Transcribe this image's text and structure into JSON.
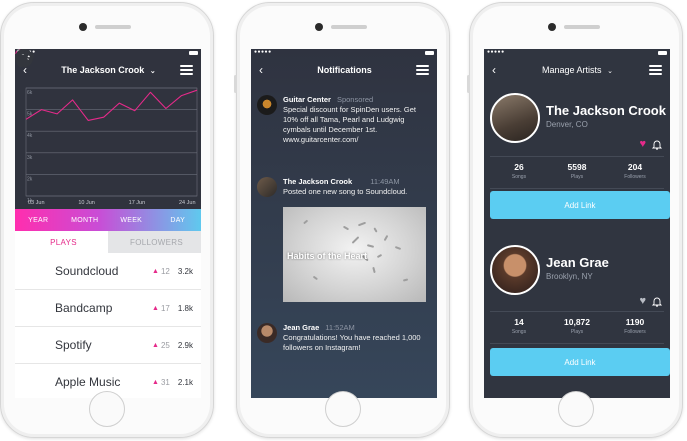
{
  "phones": {
    "analytics": {
      "header": {
        "title": "The Jackson Crook",
        "dropdown_icon": "chevron-down-icon"
      },
      "chart_data": {
        "type": "line",
        "x_ticks": [
          "03 Jun",
          "10 Jun",
          "17 Jun",
          "24 Jun"
        ],
        "y_ticks": [
          "6k",
          "5k",
          "4k",
          "3k",
          "2k",
          "1k"
        ],
        "ylim": [
          1000,
          6000
        ],
        "series": [
          {
            "values": [
              4550,
              5000,
              4800,
              5450,
              4500,
              4650,
              5300,
              4950,
              5800,
              5050,
              5650,
              5900
            ]
          }
        ],
        "line_color": "#e52a8a"
      },
      "periods": [
        "YEAR",
        "MONTH",
        "WEEK",
        "DAY"
      ],
      "tabs": {
        "plays": "PLAYS",
        "followers": "FOLLOWERS"
      },
      "services": [
        {
          "name": "Soundcloud",
          "delta": "12",
          "value": "3.2k"
        },
        {
          "name": "Bandcamp",
          "delta": "17",
          "value": "1.8k"
        },
        {
          "name": "Spotify",
          "delta": "25",
          "value": "2.9k"
        },
        {
          "name": "Apple Music",
          "delta": "31",
          "value": "2.1k"
        }
      ]
    },
    "notifications": {
      "header": {
        "title": "Notifications"
      },
      "items": [
        {
          "who": "Guitar Center",
          "meta": "Sponsored",
          "msg": "Special discount for SpinDen users. Get 10% off all Tama, Pearl and Ludgwig cymbals until December 1st. www.guitarcenter.com/"
        },
        {
          "who": "The Jackson Crook",
          "meta": "11:49AM",
          "msg": "Posted one new song to Soundcloud.",
          "image_caption": "Habits of the Heart"
        },
        {
          "who": "Jean Grae",
          "meta": "11:52AM",
          "msg": "Congratulations! You have reached 1,000 followers on Instagram!"
        }
      ]
    },
    "artists": {
      "header": {
        "title": "Manage Artists"
      },
      "items": [
        {
          "name": "The Jackson Crook",
          "location": "Denver, CO",
          "favorited": true,
          "songs": "26",
          "plays": "5598",
          "followers": "204",
          "songs_label": "Songs",
          "plays_label": "Plays",
          "followers_label": "Followers",
          "add_link": "Add Link"
        },
        {
          "name": "Jean Grae",
          "location": "Brooklyn, NY",
          "favorited": false,
          "songs": "14",
          "plays": "10,872",
          "followers": "1190",
          "songs_label": "Songs",
          "plays_label": "Plays",
          "followers_label": "Followers",
          "add_link": "Add Link"
        }
      ]
    }
  },
  "colors": {
    "accent_pink": "#e52a8a",
    "accent_blue": "#5bcdf2",
    "dark_bg": "#30333e"
  }
}
